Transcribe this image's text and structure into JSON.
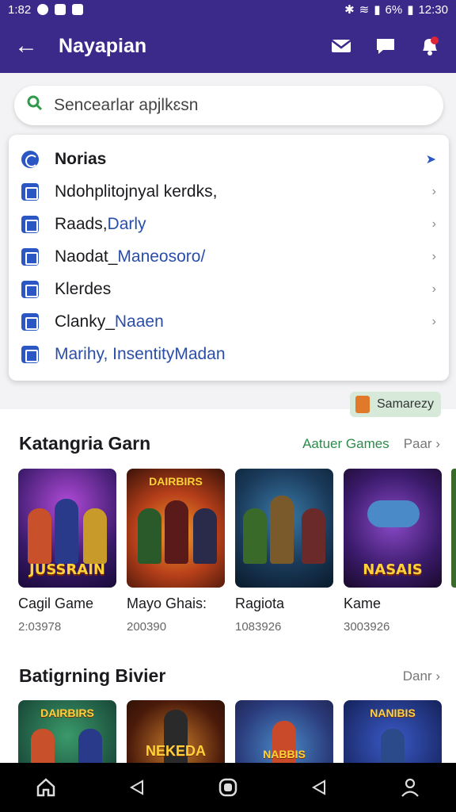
{
  "status_bar": {
    "time_left": "1:82",
    "battery": "6%",
    "time_right": "12:30"
  },
  "app_bar": {
    "title": "Nayapian"
  },
  "search": {
    "placeholder": "Sencearlar apjlkɛsn"
  },
  "menu": {
    "header": "Norias",
    "items": [
      {
        "label": "Ndohplitojnyal kerdks,"
      },
      {
        "label": "Raads, ",
        "accent": "Darly"
      },
      {
        "label": "Naodat_ ",
        "accent": "Maneosoro/"
      },
      {
        "label": "Klerdes"
      },
      {
        "label": "Clanky_ ",
        "accent": "Naaen"
      },
      {
        "label": "",
        "accent": "Marihy, InsentityMadan"
      }
    ]
  },
  "badge": {
    "label": "Samarezy"
  },
  "section1": {
    "title": "Katangria Garn",
    "link": "Aatuer Games",
    "more": "Paar",
    "games": [
      {
        "name": "Cagil Game",
        "count": "2:03978",
        "banner": "JUSSRAIN"
      },
      {
        "name": "Mayo Ghais:",
        "count": "200390",
        "banner": "DAIRBIRS"
      },
      {
        "name": "Ragiota",
        "count": "1083926",
        "banner": ""
      },
      {
        "name": "Kame",
        "count": "3003926",
        "banner": "NASAIS"
      }
    ]
  },
  "section2": {
    "title": "Batigrning Bivier",
    "more": "Danr",
    "games": [
      {
        "banner": "DAIRBIRS"
      },
      {
        "banner": "NEKEDA"
      },
      {
        "banner": "NABBIS"
      },
      {
        "banner": "NANIBIS"
      }
    ]
  },
  "colors": {
    "primary": "#3b2a8a",
    "accent_blue": "#2a57c4",
    "accent_green": "#2e8a4a"
  }
}
